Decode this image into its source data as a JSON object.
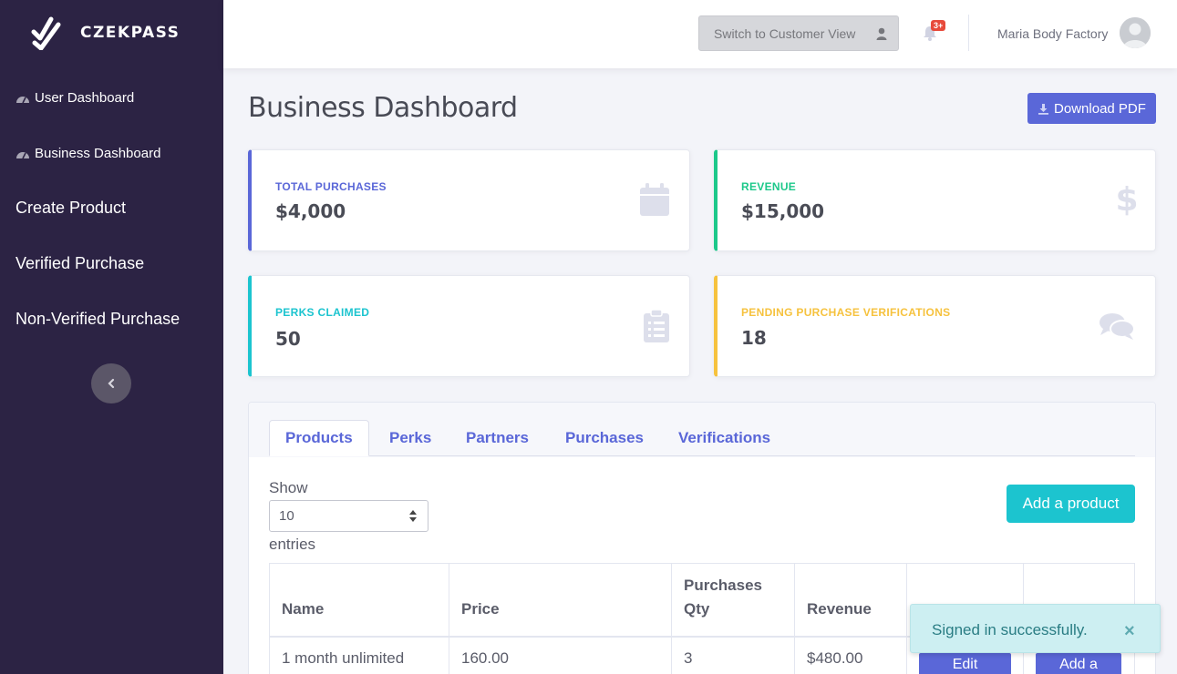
{
  "brand": {
    "name": "CZEKPASS"
  },
  "sidebar": {
    "items": [
      {
        "label": "User Dashboard"
      },
      {
        "label": "Business Dashboard"
      },
      {
        "label": "Create Product"
      },
      {
        "label": "Verified Purchase"
      },
      {
        "label": "Non-Verified Purchase"
      }
    ]
  },
  "topbar": {
    "switch_view_label": "Switch to Customer View",
    "notification_badge": "3+",
    "user_name": "Maria Body Factory"
  },
  "page": {
    "title": "Business Dashboard",
    "download_label": "Download PDF"
  },
  "cards": [
    {
      "label": "TOTAL PURCHASES",
      "value": "$4,000",
      "color": "#5a67d8",
      "icon": "calendar-icon"
    },
    {
      "label": "REVENUE",
      "value": "$15,000",
      "color": "#1cc88a",
      "icon": "dollar-icon"
    },
    {
      "label": "PERKS CLAIMED",
      "value": "50",
      "color": "#1cc4cf",
      "icon": "clipboard-icon"
    },
    {
      "label": "PENDING PURCHASE VERIFICATIONS",
      "value": "18",
      "color": "#f6c23e",
      "icon": "comments-icon"
    }
  ],
  "tabs": [
    {
      "label": "Products"
    },
    {
      "label": "Perks"
    },
    {
      "label": "Partners"
    },
    {
      "label": "Purchases"
    },
    {
      "label": "Verifications"
    }
  ],
  "table_controls": {
    "show_label": "Show",
    "entries_value": "10",
    "entries_label": "entries",
    "add_label": "Add a product"
  },
  "table": {
    "columns": [
      "Name",
      "Price",
      "Purchases Qty",
      "Revenue",
      "",
      ""
    ],
    "rows": [
      {
        "name": "1 month unlimited",
        "price": "160.00",
        "qty": "3",
        "revenue": "$480.00",
        "edit_label": "Edit",
        "add_label": "Add a"
      }
    ]
  },
  "toast": {
    "message": "Signed in successfully.",
    "close": "×"
  }
}
